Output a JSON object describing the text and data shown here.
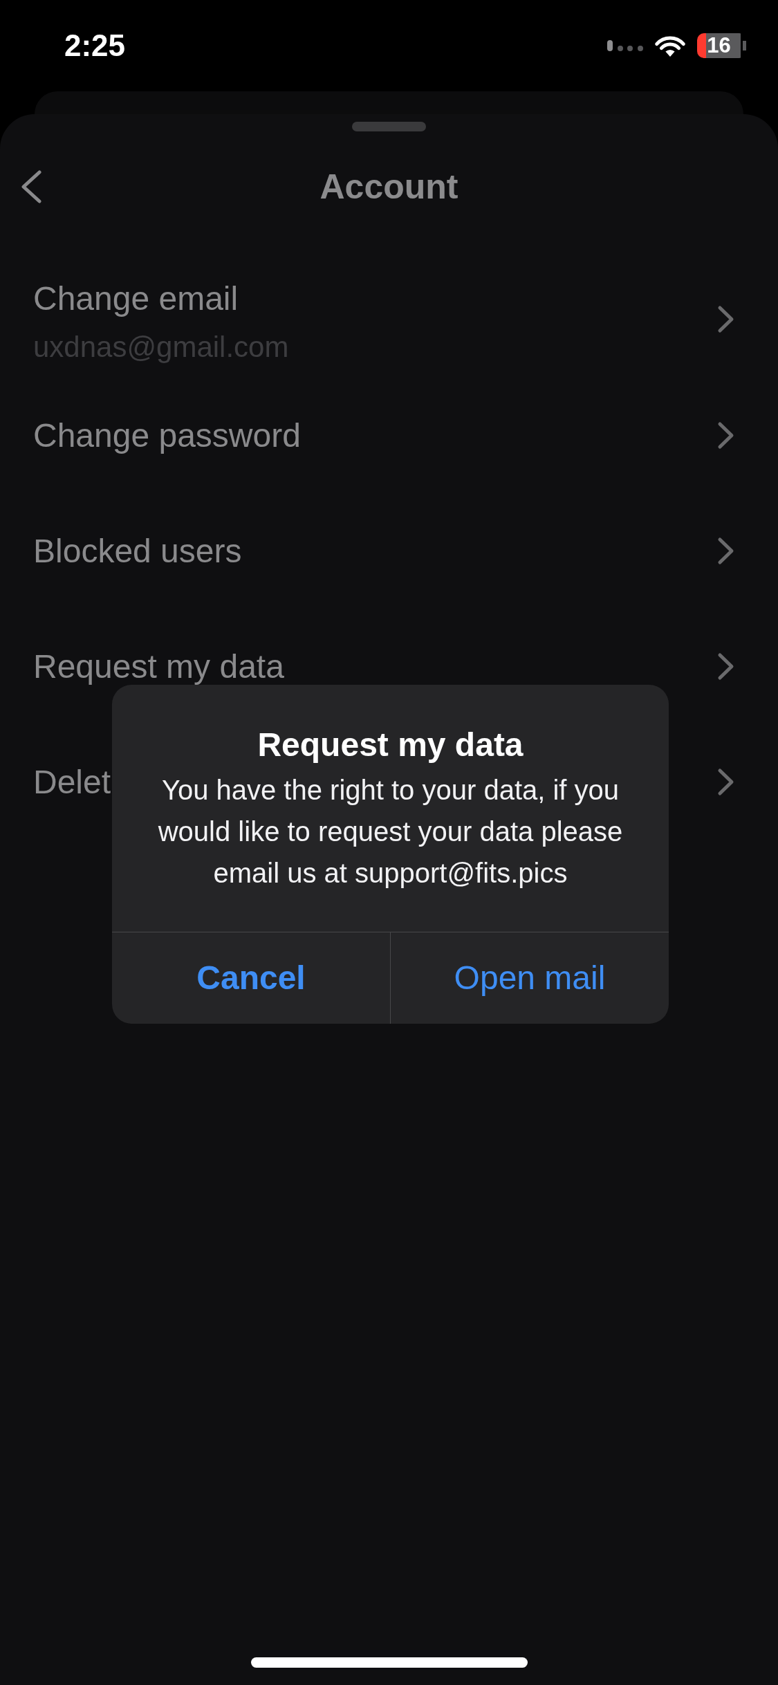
{
  "status_bar": {
    "time": "2:25",
    "battery": "16"
  },
  "header": {
    "title": "Account"
  },
  "rows": [
    {
      "title": "Change email",
      "subtitle": "uxdnas@gmail.com"
    },
    {
      "title": "Change password"
    },
    {
      "title": "Blocked users"
    },
    {
      "title": "Request my data"
    },
    {
      "title": "Delet"
    }
  ],
  "alert": {
    "title": "Request my data",
    "message": "You have the right to your data, if you would like to request your data please email us at support@fits.pics",
    "buttons": [
      {
        "label": "Cancel",
        "kind": "cancel"
      },
      {
        "label": "Open mail",
        "kind": "default"
      }
    ]
  }
}
